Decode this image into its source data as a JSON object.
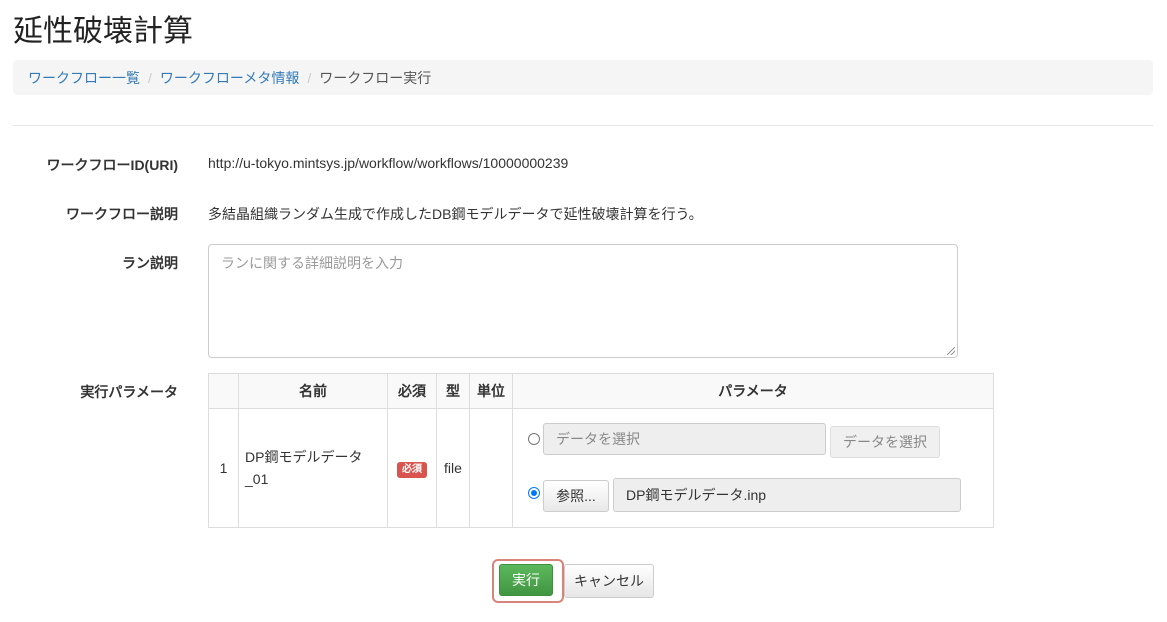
{
  "page": {
    "title": "延性破壊計算"
  },
  "breadcrumb": {
    "items": [
      {
        "label": "ワークフロー一覧"
      },
      {
        "label": "ワークフローメタ情報"
      },
      {
        "label": "ワークフロー実行"
      }
    ],
    "separator": "/"
  },
  "form": {
    "workflow_id_label": "ワークフローID(URI)",
    "workflow_id_value": "http://u-tokyo.mintsys.jp/workflow/workflows/10000000239",
    "workflow_desc_label": "ワークフロー説明",
    "workflow_desc_value": "多結晶組織ランダム生成で作成したDB鋼モデルデータで延性破壊計算を行う。",
    "run_desc_label": "ラン説明",
    "run_desc_placeholder": "ランに関する詳細説明を入力",
    "params_label": "実行パラメータ"
  },
  "params_table": {
    "headers": [
      "",
      "名前",
      "必須",
      "型",
      "単位",
      "パラメータ"
    ],
    "rows": [
      {
        "index": "1",
        "name": "DP鋼モデルデータ_01",
        "required_badge": "必須",
        "type": "file",
        "unit": "",
        "option_select": {
          "checked": false,
          "placeholder": "データを選択",
          "button_label": "データを選択"
        },
        "option_browse": {
          "checked": true,
          "button_label": "参照...",
          "file_name": "DP鋼モデルデータ.inp"
        }
      }
    ]
  },
  "actions": {
    "run_label": "実行",
    "cancel_label": "キャンセル"
  },
  "colors": {
    "link": "#337ab7",
    "required_badge": "#d9534f",
    "run_button": "#5cb85c"
  }
}
